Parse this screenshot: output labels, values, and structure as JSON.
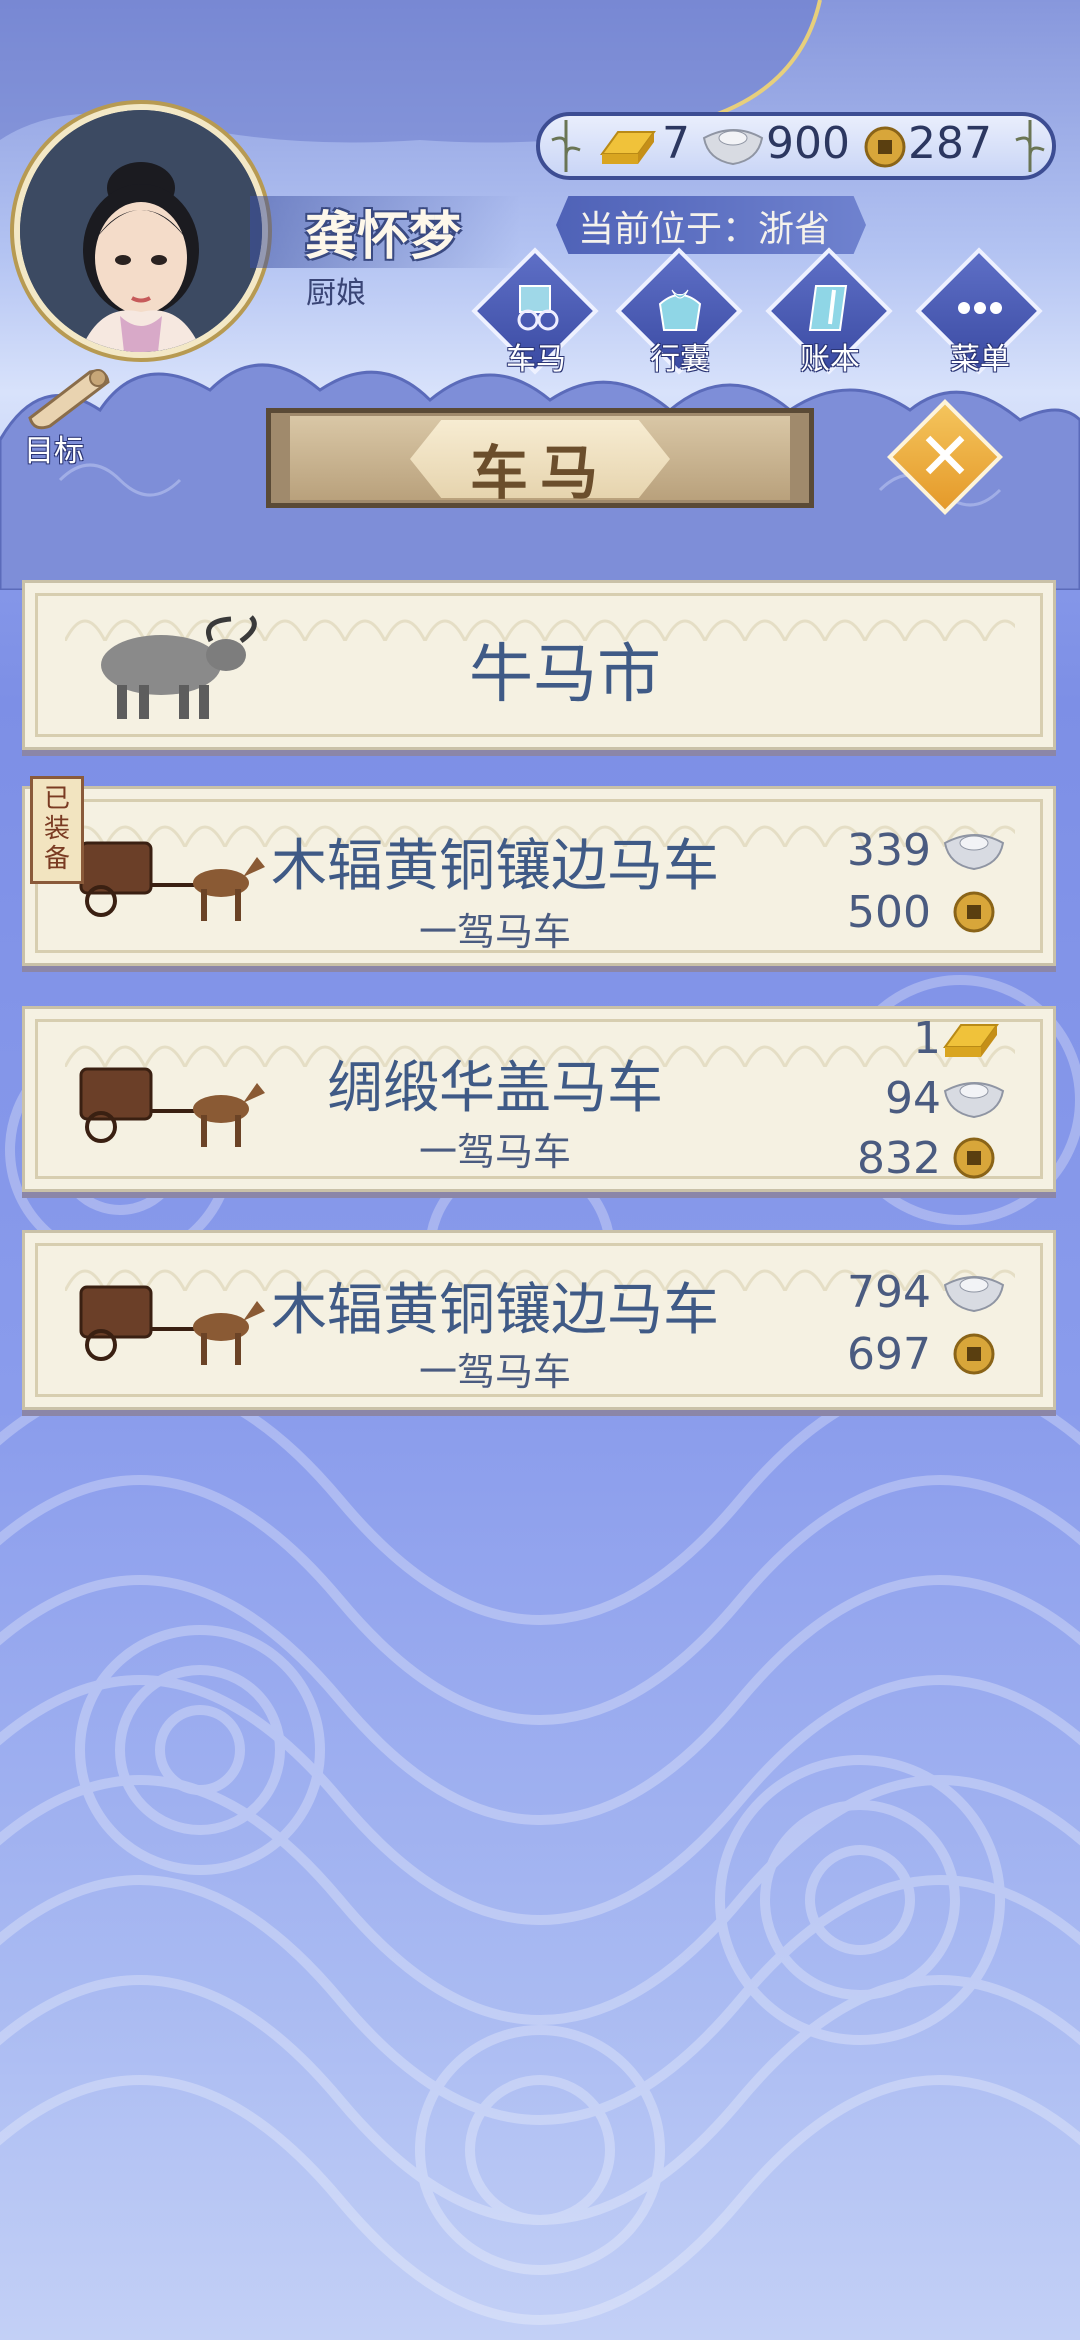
{
  "player": {
    "name": "龚怀梦",
    "role": "厨娘"
  },
  "currency": {
    "gold": "7",
    "silver": "900",
    "coin": "287"
  },
  "location": {
    "text": "当前位于：浙省"
  },
  "nav": [
    {
      "label": "车马",
      "icon": "carriage-icon"
    },
    {
      "label": "行囊",
      "icon": "bundle-icon"
    },
    {
      "label": "账本",
      "icon": "ledger-icon"
    },
    {
      "label": "菜单",
      "icon": "menu-icon"
    }
  ],
  "goal": {
    "label": "目标"
  },
  "panel": {
    "title": "车马"
  },
  "market": {
    "label": "牛马市"
  },
  "carriages": [
    {
      "name": "木辐黄铜镶边马车",
      "type": "一驾马车",
      "equipped": true,
      "equipped_label": "已\n装\n备",
      "prices": [
        {
          "currency": "silver",
          "amount": "339"
        },
        {
          "currency": "coin",
          "amount": "500"
        }
      ]
    },
    {
      "name": "绸缎华盖马车",
      "type": "一驾马车",
      "equipped": false,
      "prices": [
        {
          "currency": "gold",
          "amount": "1"
        },
        {
          "currency": "silver",
          "amount": "94"
        },
        {
          "currency": "coin",
          "amount": "832"
        }
      ]
    },
    {
      "name": "木辐黄铜镶边马车",
      "type": "一驾马车",
      "equipped": false,
      "prices": [
        {
          "currency": "silver",
          "amount": "794"
        },
        {
          "currency": "coin",
          "amount": "697"
        }
      ]
    }
  ],
  "colors": {
    "accent": "#3f5a86",
    "card_bg": "#f5f1e2",
    "banner": "#a08a6c"
  }
}
